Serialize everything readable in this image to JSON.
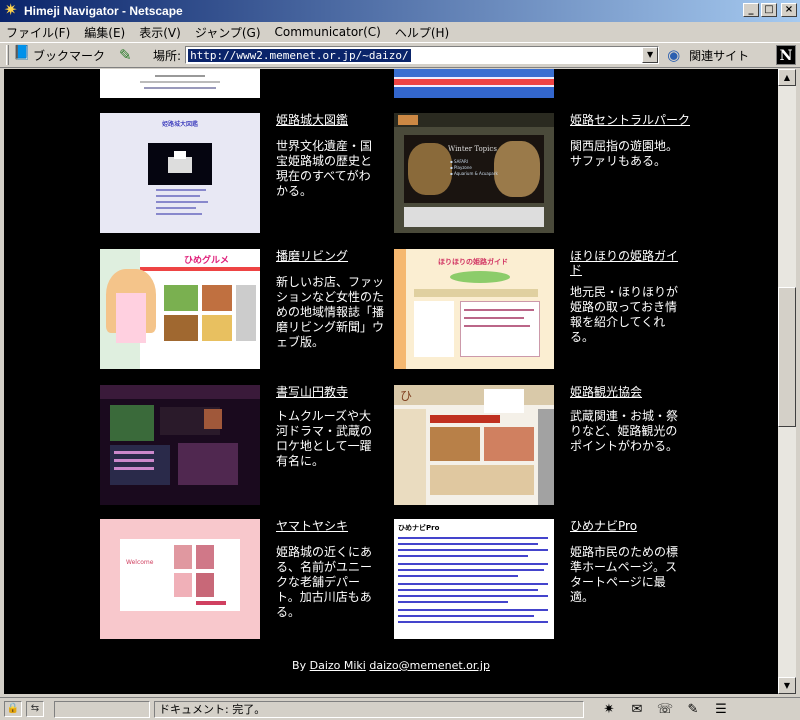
{
  "window": {
    "title": "Himeji Navigator - Netscape",
    "buttons": {
      "minimize": "_",
      "maximize": "□",
      "close": "×"
    }
  },
  "menu": [
    "ファイル(F)",
    "編集(E)",
    "表示(V)",
    "ジャンプ(G)",
    "Communicator(C)",
    "ヘルプ(H)"
  ],
  "toolbar": {
    "bookmarks_label": "ブックマーク",
    "location_label": "場所:",
    "url": "http://www2.memenet.or.jp/~daizo/",
    "related_label": "関連サイト",
    "logo": "N"
  },
  "sites": [
    {
      "title": "姫路城大図鑑",
      "desc": "世界文化遺産・国宝姫路城の歴史と現在のすべてがわかる。"
    },
    {
      "title": "姫路セントラルパーク",
      "desc": "関西屈指の遊園地。サファリもある。"
    },
    {
      "title": "播磨リビング",
      "desc": "新しいお店、ファッションなど女性のための地域情報誌「播磨リビング新聞」ウェブ版。"
    },
    {
      "title": "ほりほりの姫路ガイド",
      "desc": "地元民・ほりほりが姫路の取っておき情報を紹介してくれる。"
    },
    {
      "title": "書写山円教寺",
      "desc": "トムクルーズや大河ドラマ・武蔵のロケ地として一躍有名に。"
    },
    {
      "title": "姫路観光協会",
      "desc": "武蔵関連・お城・祭りなど、姫路観光のポイントがわかる。"
    },
    {
      "title": "ヤマトヤシキ",
      "desc": "姫路城の近くにある、名前がユニークな老舗デパート。加古川店もある。"
    },
    {
      "title": "ひめナビPro",
      "desc": "姫路市民のための標準ホームページ。スタートページに最適。"
    }
  ],
  "thumb_text": {
    "zukan": "姫路城大図鑑",
    "winter": "Winter Topics",
    "winter_items": [
      "▪ SAFARI",
      "▪ Playzone",
      "▪ Aquarium & Acuapark"
    ],
    "gourmet": "ひめグルメ",
    "guide": "ほりほりの姫路ガイド",
    "yamato": "Welcome",
    "himenavi": "ひめナビPro"
  },
  "footer": {
    "by": "By",
    "author": "Daizo Miki",
    "email": "daizo@memenet.or.jp"
  },
  "status": {
    "text": "ドキュメント: 完了。"
  }
}
